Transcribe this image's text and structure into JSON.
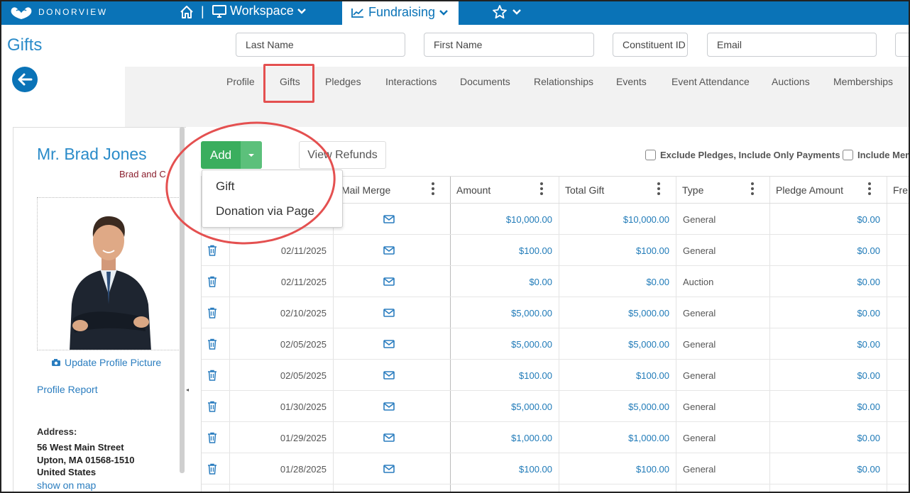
{
  "topbar": {
    "logo_text": "DONORVIEW",
    "workspace_label": "Workspace",
    "fundraising_label": "Fundraising"
  },
  "page": {
    "title": "Gifts"
  },
  "search": {
    "last_name": "Last Name",
    "first_name": "First Name",
    "constituent_id": "Constituent ID",
    "email": "Email"
  },
  "tabs": [
    "Profile",
    "Gifts",
    "Pledges",
    "Interactions",
    "Documents",
    "Relationships",
    "Events",
    "Event Attendance",
    "Auctions",
    "Memberships"
  ],
  "active_tab": "Gifts",
  "profile": {
    "name": "Mr. Brad Jones",
    "subtitle": "Brad and C",
    "update_picture": "Update Profile Picture",
    "profile_report": "Profile Report",
    "address_label": "Address:",
    "address_lines": [
      "56 West Main Street",
      "Upton, MA 01568-1510",
      "United States"
    ],
    "show_on_map": "show on map"
  },
  "toolbar": {
    "add_label": "Add",
    "view_refunds": "View Refunds",
    "exclude_pledges": "Exclude Pledges, Include Only Payments",
    "include_mem": "Include Mem"
  },
  "dropdown": {
    "items": [
      "Gift",
      "Donation via Page"
    ]
  },
  "table": {
    "headers": [
      "Mail Merge",
      "Amount",
      "Total Gift",
      "Type",
      "Pledge Amount",
      "Fre"
    ],
    "rows": [
      {
        "date": "",
        "amount": "$10,000.00",
        "total": "$10,000.00",
        "type": "General",
        "pledge": "$0.00"
      },
      {
        "date": "02/11/2025",
        "amount": "$100.00",
        "total": "$100.00",
        "type": "General",
        "pledge": "$0.00"
      },
      {
        "date": "02/11/2025",
        "amount": "$0.00",
        "total": "$0.00",
        "type": "Auction",
        "pledge": "$0.00"
      },
      {
        "date": "02/10/2025",
        "amount": "$5,000.00",
        "total": "$5,000.00",
        "type": "General",
        "pledge": "$0.00"
      },
      {
        "date": "02/05/2025",
        "amount": "$5,000.00",
        "total": "$5,000.00",
        "type": "General",
        "pledge": "$0.00"
      },
      {
        "date": "02/05/2025",
        "amount": "$100.00",
        "total": "$100.00",
        "type": "General",
        "pledge": "$0.00"
      },
      {
        "date": "01/30/2025",
        "amount": "$5,000.00",
        "total": "$5,000.00",
        "type": "General",
        "pledge": "$0.00"
      },
      {
        "date": "01/29/2025",
        "amount": "$1,000.00",
        "total": "$1,000.00",
        "type": "General",
        "pledge": "$0.00"
      },
      {
        "date": "01/28/2025",
        "amount": "$100.00",
        "total": "$100.00",
        "type": "General",
        "pledge": "$0.00"
      }
    ]
  },
  "colors": {
    "brand_blue": "#0a73b7",
    "link_blue": "#1f7ab8",
    "add_green": "#3aae5e",
    "highlight_red": "#e45050"
  }
}
